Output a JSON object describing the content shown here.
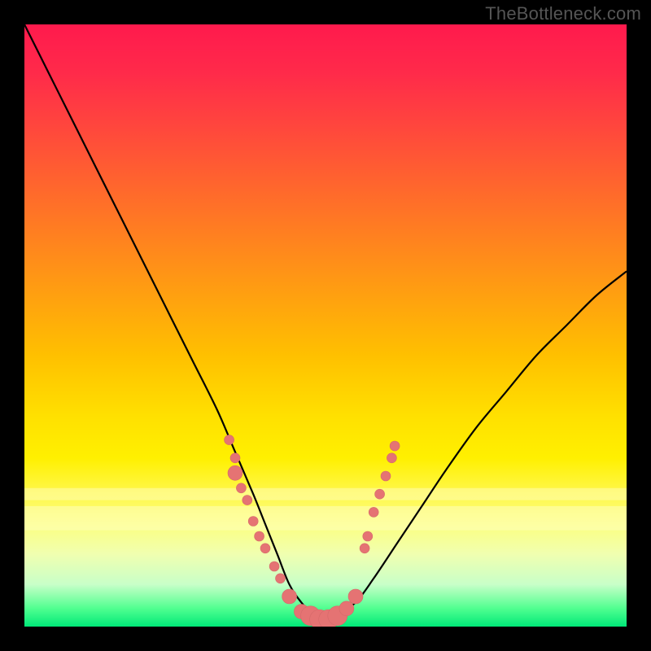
{
  "watermark": "TheBottleneck.com",
  "chart_data": {
    "type": "line",
    "title": "",
    "xlabel": "",
    "ylabel": "",
    "xlim": [
      0,
      100
    ],
    "ylim": [
      0,
      100
    ],
    "grid": false,
    "legend": false,
    "series": [
      {
        "name": "bottleneck-curve",
        "x": [
          0,
          4,
          8,
          12,
          16,
          20,
          24,
          28,
          32,
          35,
          38,
          40,
          42,
          44,
          46,
          48,
          50,
          52,
          55,
          58,
          62,
          66,
          70,
          75,
          80,
          85,
          90,
          95,
          100
        ],
        "y": [
          100,
          92,
          84,
          76,
          68,
          60,
          52,
          44,
          36,
          29,
          22,
          17,
          12,
          7,
          4,
          2,
          1,
          2,
          4,
          8,
          14,
          20,
          26,
          33,
          39,
          45,
          50,
          55,
          59
        ]
      }
    ],
    "markers": [
      {
        "x": 34.0,
        "y": 31.0,
        "size": "s"
      },
      {
        "x": 35.0,
        "y": 28.0,
        "size": "s"
      },
      {
        "x": 35.0,
        "y": 25.5,
        "size": "m"
      },
      {
        "x": 36.0,
        "y": 23.0,
        "size": "s"
      },
      {
        "x": 37.0,
        "y": 21.0,
        "size": "s"
      },
      {
        "x": 38.0,
        "y": 17.5,
        "size": "s"
      },
      {
        "x": 39.0,
        "y": 15.0,
        "size": "s"
      },
      {
        "x": 40.0,
        "y": 13.0,
        "size": "s"
      },
      {
        "x": 41.5,
        "y": 10.0,
        "size": "s"
      },
      {
        "x": 42.5,
        "y": 8.0,
        "size": "s"
      },
      {
        "x": 44.0,
        "y": 5.0,
        "size": "m"
      },
      {
        "x": 46.0,
        "y": 2.5,
        "size": "m"
      },
      {
        "x": 47.5,
        "y": 1.8,
        "size": "l"
      },
      {
        "x": 49.0,
        "y": 1.2,
        "size": "l"
      },
      {
        "x": 50.5,
        "y": 1.2,
        "size": "l"
      },
      {
        "x": 52.0,
        "y": 1.8,
        "size": "l"
      },
      {
        "x": 53.5,
        "y": 3.0,
        "size": "m"
      },
      {
        "x": 55.0,
        "y": 5.0,
        "size": "m"
      },
      {
        "x": 56.5,
        "y": 13.0,
        "size": "s"
      },
      {
        "x": 57.0,
        "y": 15.0,
        "size": "s"
      },
      {
        "x": 58.0,
        "y": 19.0,
        "size": "s"
      },
      {
        "x": 59.0,
        "y": 22.0,
        "size": "s"
      },
      {
        "x": 60.0,
        "y": 25.0,
        "size": "s"
      },
      {
        "x": 61.0,
        "y": 28.0,
        "size": "s"
      },
      {
        "x": 61.5,
        "y": 30.0,
        "size": "s"
      }
    ],
    "pale_bands_y": [
      {
        "from": 16,
        "to": 20
      },
      {
        "from": 21,
        "to": 23
      }
    ],
    "background_gradient": {
      "top": "#ff1a4d",
      "mid": "#ffe000",
      "bottom": "#00e878"
    }
  }
}
